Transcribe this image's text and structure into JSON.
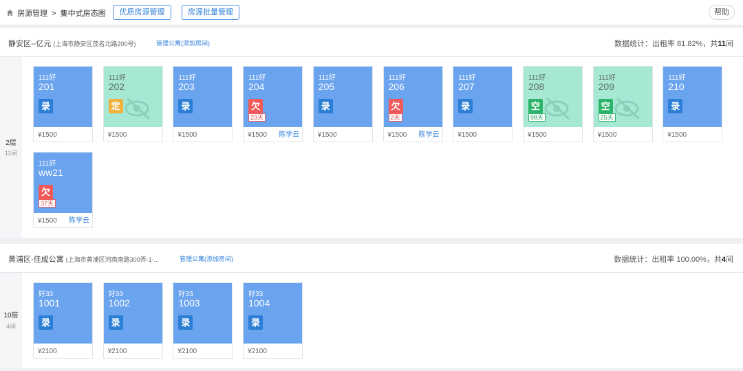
{
  "header": {
    "breadcrumb_root": "房源管理",
    "breadcrumb_sep": ">",
    "breadcrumb_current": "集中式房态图",
    "btn_quality": "优质房源管理",
    "btn_batch": "房源批量管理",
    "btn_help": "帮助"
  },
  "sections": [
    {
      "name": "静安区--亿元",
      "address": "(上海市静安区茂名北路200号)",
      "manage": "管理公寓(添加房间)",
      "stats_prefix": "数据统计：出租率 81.82%，共",
      "stats_count": "11",
      "stats_suffix": "间",
      "floor": "2层",
      "floor_count": "11间",
      "rooms": [
        {
          "building": "111好",
          "number": "201",
          "status": "录",
          "status_type": "lu",
          "price": "¥1500",
          "tenant": "",
          "days": "",
          "vacant": false
        },
        {
          "building": "111好",
          "number": "202",
          "status": "定",
          "status_type": "ding",
          "price": "¥1500",
          "tenant": "",
          "days": "",
          "vacant": true
        },
        {
          "building": "111好",
          "number": "203",
          "status": "录",
          "status_type": "lu",
          "price": "¥1500",
          "tenant": "",
          "days": "",
          "vacant": false
        },
        {
          "building": "111好",
          "number": "204",
          "status": "欠",
          "status_type": "qian",
          "price": "¥1500",
          "tenant": "陈学云",
          "days": "23天",
          "vacant": false
        },
        {
          "building": "111好",
          "number": "205",
          "status": "录",
          "status_type": "lu",
          "price": "¥1500",
          "tenant": "",
          "days": "",
          "vacant": false
        },
        {
          "building": "111好",
          "number": "206",
          "status": "欠",
          "status_type": "qian",
          "price": "¥1500",
          "tenant": "陈学云",
          "days": "2天",
          "vacant": false
        },
        {
          "building": "111好",
          "number": "207",
          "status": "录",
          "status_type": "lu",
          "price": "¥1500",
          "tenant": "",
          "days": "",
          "vacant": false
        },
        {
          "building": "111好",
          "number": "208",
          "status": "空",
          "status_type": "kong",
          "price": "¥1500",
          "tenant": "",
          "days": "98天",
          "vacant": true
        },
        {
          "building": "111好",
          "number": "209",
          "status": "空",
          "status_type": "kong",
          "price": "¥1500",
          "tenant": "",
          "days": "25天",
          "vacant": true
        },
        {
          "building": "111好",
          "number": "210",
          "status": "录",
          "status_type": "lu",
          "price": "¥1500",
          "tenant": "",
          "days": "",
          "vacant": false
        },
        {
          "building": "111好",
          "number": "ww21",
          "status": "欠",
          "status_type": "qian",
          "price": "¥1500",
          "tenant": "陈学云",
          "days": "37天",
          "vacant": false
        }
      ]
    },
    {
      "name": "黄浦区-佳成公寓",
      "address": "(上海市黄浦区河南南路300弄-1-...",
      "manage": "管理公寓(添加房间)",
      "stats_prefix": "数据统计：出租率 100.00%，共",
      "stats_count": "4",
      "stats_suffix": "间",
      "floor": "10层",
      "floor_count": "4间",
      "rooms": [
        {
          "building": "好33",
          "number": "1001",
          "status": "录",
          "status_type": "lu",
          "price": "¥2100",
          "tenant": "",
          "days": "",
          "vacant": false
        },
        {
          "building": "好33",
          "number": "1002",
          "status": "录",
          "status_type": "lu",
          "price": "¥2100",
          "tenant": "",
          "days": "",
          "vacant": false
        },
        {
          "building": "好33",
          "number": "1003",
          "status": "录",
          "status_type": "lu",
          "price": "¥2100",
          "tenant": "",
          "days": "",
          "vacant": false
        },
        {
          "building": "好33",
          "number": "1004",
          "status": "录",
          "status_type": "lu",
          "price": "¥2100",
          "tenant": "",
          "days": "",
          "vacant": false
        }
      ]
    }
  ],
  "colors": {
    "room_rented": "#6aa3ee",
    "room_vacant": "#a7e8d5",
    "badge_lu": "#2c7fd6",
    "badge_ding": "#f0b23d",
    "badge_qian": "#f05a5a",
    "badge_kong": "#2cb46a",
    "link": "#2f7fd8"
  }
}
